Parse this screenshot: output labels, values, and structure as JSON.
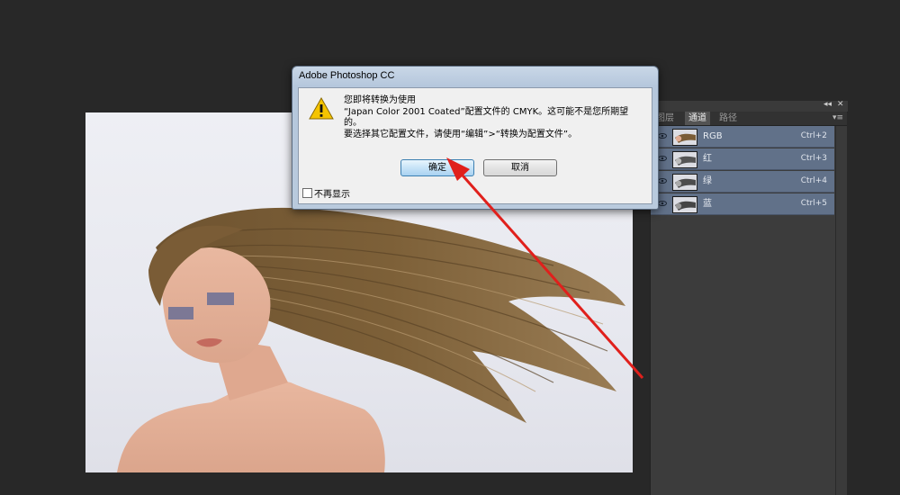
{
  "dialog": {
    "title": "Adobe Photoshop CC",
    "message_lines": [
      "您即将转换为使用",
      "“Japan Color 2001 Coated”配置文件的 CMYK。这可能不是您所期望",
      "的。",
      "要选择其它配置文件，请使用“编辑”>“转换为配置文件”。"
    ],
    "ok_label": "确定",
    "cancel_label": "取消",
    "checkbox_label": "不再显示",
    "checkbox_checked": false,
    "warning_icon": "warning-triangle-icon"
  },
  "panel": {
    "collapse_glyph": "◂◂",
    "close_glyph": "✕",
    "menu_glyph": "▾≡",
    "tabs": [
      {
        "label": "图层",
        "active": false
      },
      {
        "label": "通道",
        "active": true
      },
      {
        "label": "路径",
        "active": false
      }
    ],
    "channels": [
      {
        "name": "RGB",
        "shortcut": "Ctrl+2"
      },
      {
        "name": "红",
        "shortcut": "Ctrl+3"
      },
      {
        "name": "绿",
        "shortcut": "Ctrl+4"
      },
      {
        "name": "蓝",
        "shortcut": "Ctrl+5"
      }
    ]
  },
  "colors": {
    "background": "#282828",
    "panel": "#3c3c3c",
    "channel_selected": "#617189",
    "dialog_frame": "#b9cadd",
    "annotation_arrow": "#e0201c"
  }
}
